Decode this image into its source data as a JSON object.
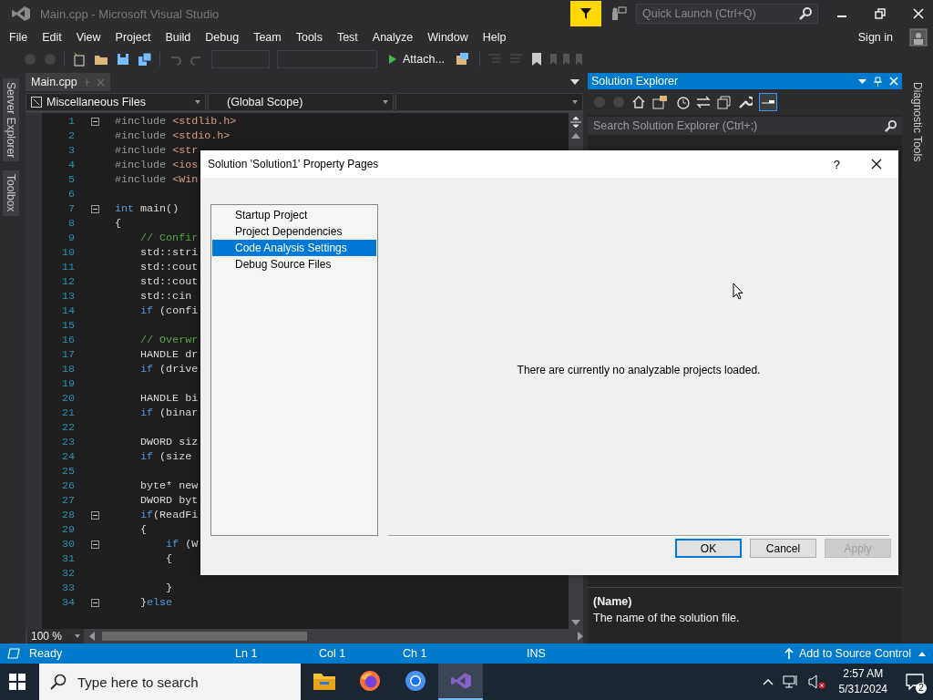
{
  "window": {
    "title": "Main.cpp - Microsoft Visual Studio",
    "active": false
  },
  "quick_launch": {
    "placeholder": "Quick Launch (Ctrl+Q)"
  },
  "menu": [
    "File",
    "Edit",
    "View",
    "Project",
    "Build",
    "Debug",
    "Team",
    "Tools",
    "Test",
    "Analyze",
    "Window",
    "Help"
  ],
  "sign_in": "Sign in",
  "toolbar": {
    "attach": "Attach..."
  },
  "side_tabs_left": [
    "Server Explorer",
    "Toolbox"
  ],
  "side_tabs_right": [
    "Diagnostic Tools"
  ],
  "editor": {
    "tab": "Main.cpp",
    "project": "Miscellaneous Files",
    "scope": "(Global Scope)",
    "zoom": "100 %",
    "lines": [
      {
        "number": "1",
        "fold": true,
        "tokens": [
          {
            "kind": "pp",
            "text": "#include "
          },
          {
            "kind": "str",
            "text": "<stdlib.h>"
          }
        ]
      },
      {
        "number": "2",
        "fold": false,
        "tokens": [
          {
            "kind": "pp",
            "text": "#include "
          },
          {
            "kind": "str",
            "text": "<stdio.h>"
          }
        ]
      },
      {
        "number": "3",
        "fold": false,
        "tokens": [
          {
            "kind": "pp",
            "text": "#include "
          },
          {
            "kind": "str",
            "text": "<str"
          }
        ]
      },
      {
        "number": "4",
        "fold": false,
        "tokens": [
          {
            "kind": "pp",
            "text": "#include "
          },
          {
            "kind": "str",
            "text": "<ios"
          }
        ]
      },
      {
        "number": "5",
        "fold": false,
        "tokens": [
          {
            "kind": "pp",
            "text": "#include "
          },
          {
            "kind": "str",
            "text": "<Win"
          }
        ]
      },
      {
        "number": "6",
        "fold": false
      },
      {
        "number": "7",
        "fold": true,
        "tokens": [
          {
            "kind": "kw",
            "text": "int"
          },
          {
            "kind": "plain",
            "text": " main()"
          }
        ]
      },
      {
        "number": "8",
        "fold": false,
        "tokens": [
          {
            "kind": "plain",
            "text": "{"
          }
        ]
      },
      {
        "number": "9",
        "fold": false,
        "tokens": [
          {
            "kind": "cm",
            "text": "    // Confir"
          }
        ]
      },
      {
        "number": "10",
        "fold": false,
        "tokens": [
          {
            "kind": "plain",
            "text": "    std::stri"
          }
        ]
      },
      {
        "number": "11",
        "fold": false,
        "tokens": [
          {
            "kind": "plain",
            "text": "    std::cout"
          }
        ]
      },
      {
        "number": "12",
        "fold": false,
        "tokens": [
          {
            "kind": "plain",
            "text": "    std::cout"
          }
        ]
      },
      {
        "number": "13",
        "fold": false,
        "tokens": [
          {
            "kind": "plain",
            "text": "    std::cin"
          }
        ]
      },
      {
        "number": "14",
        "fold": false,
        "tokens": [
          {
            "kind": "kw",
            "text": "    if"
          },
          {
            "kind": "plain",
            "text": " (confi"
          }
        ]
      },
      {
        "number": "15",
        "fold": false
      },
      {
        "number": "16",
        "fold": false,
        "tokens": [
          {
            "kind": "cm",
            "text": "    // Overwr"
          }
        ]
      },
      {
        "number": "17",
        "fold": false,
        "tokens": [
          {
            "kind": "plain",
            "text": "    HANDLE dr"
          }
        ]
      },
      {
        "number": "18",
        "fold": false,
        "tokens": [
          {
            "kind": "kw",
            "text": "    if"
          },
          {
            "kind": "plain",
            "text": " (drive"
          }
        ]
      },
      {
        "number": "19",
        "fold": false
      },
      {
        "number": "20",
        "fold": false,
        "tokens": [
          {
            "kind": "plain",
            "text": "    HANDLE bi"
          }
        ]
      },
      {
        "number": "21",
        "fold": false,
        "tokens": [
          {
            "kind": "kw",
            "text": "    if"
          },
          {
            "kind": "plain",
            "text": " (binar"
          }
        ]
      },
      {
        "number": "22",
        "fold": false
      },
      {
        "number": "23",
        "fold": false,
        "tokens": [
          {
            "kind": "plain",
            "text": "    DWORD siz"
          }
        ]
      },
      {
        "number": "24",
        "fold": false,
        "tokens": [
          {
            "kind": "kw",
            "text": "    if"
          },
          {
            "kind": "plain",
            "text": " (size"
          }
        ]
      },
      {
        "number": "25",
        "fold": false
      },
      {
        "number": "26",
        "fold": false,
        "tokens": [
          {
            "kind": "plain",
            "text": "    byte* new"
          }
        ]
      },
      {
        "number": "27",
        "fold": false,
        "tokens": [
          {
            "kind": "plain",
            "text": "    DWORD byt"
          }
        ]
      },
      {
        "number": "28",
        "fold": true,
        "tokens": [
          {
            "kind": "kw",
            "text": "    if"
          },
          {
            "kind": "plain",
            "text": "(ReadFi"
          }
        ]
      },
      {
        "number": "29",
        "fold": false,
        "tokens": [
          {
            "kind": "plain",
            "text": "    {"
          }
        ]
      },
      {
        "number": "30",
        "fold": true,
        "tokens": [
          {
            "kind": "kw",
            "text": "        if"
          },
          {
            "kind": "plain",
            "text": " (W"
          }
        ]
      },
      {
        "number": "31",
        "fold": false,
        "tokens": [
          {
            "kind": "plain",
            "text": "        {"
          }
        ]
      },
      {
        "number": "32",
        "fold": false
      },
      {
        "number": "33",
        "fold": false,
        "tokens": [
          {
            "kind": "plain",
            "text": "        }"
          }
        ]
      },
      {
        "number": "34",
        "fold": true,
        "tokens": [
          {
            "kind": "plain",
            "text": "    }"
          },
          {
            "kind": "kw",
            "text": "else"
          }
        ]
      }
    ]
  },
  "solution_explorer": {
    "title": "Solution Explorer",
    "search": {
      "placeholder": "Search Solution Explorer (Ctrl+;)"
    }
  },
  "properties": {
    "name": "(Name)",
    "description": "The name of the solution file."
  },
  "status_bar": {
    "state": "Ready",
    "line": "Ln 1",
    "column": "Col 1",
    "char": "Ch 1",
    "mode": "INS",
    "source_control": "Add to Source Control"
  },
  "taskbar": {
    "search": {
      "placeholder": "Type here to search"
    },
    "apps": [
      {
        "kind": "folder",
        "selected": false
      },
      {
        "kind": "firefox",
        "selected": false
      },
      {
        "kind": "chrome",
        "selected": false
      },
      {
        "kind": "studio",
        "selected": true
      }
    ],
    "time": "2:57 AM",
    "date": "5/31/2024",
    "notifications": "2"
  },
  "dialog": {
    "title": "Solution 'Solution1' Property Pages",
    "help": "?",
    "pages": [
      {
        "label": "Startup Project",
        "selected": false
      },
      {
        "label": "Project Dependencies",
        "selected": false
      },
      {
        "label": "Code Analysis Settings",
        "selected": true
      },
      {
        "label": "Debug Source Files",
        "selected": false
      }
    ],
    "message": "There are currently no analyzable projects loaded.",
    "buttons": [
      {
        "label": "OK",
        "default": true,
        "disabled": false
      },
      {
        "label": "Cancel",
        "default": false,
        "disabled": false
      },
      {
        "label": "Apply",
        "default": false,
        "disabled": true
      }
    ]
  }
}
